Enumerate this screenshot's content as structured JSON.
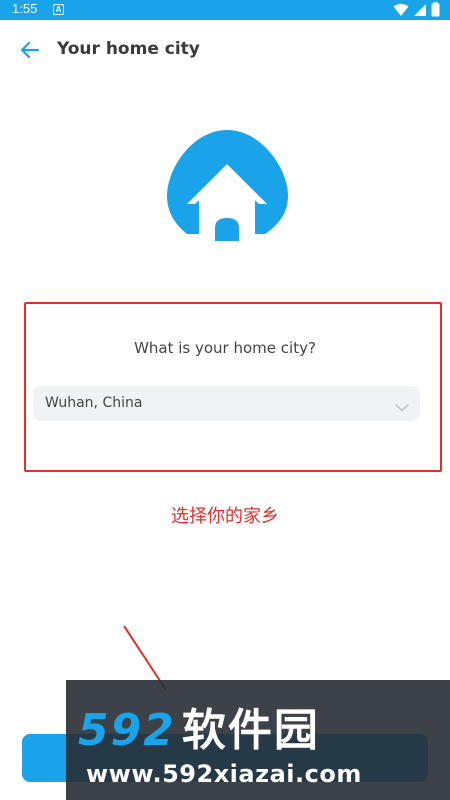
{
  "status_bar": {
    "time": "1:55",
    "notification_badge": "A",
    "icons": [
      "wifi-icon",
      "signal-icon",
      "battery-icon"
    ]
  },
  "header": {
    "title": "Your home city",
    "back_icon": "back-arrow-icon"
  },
  "illustration": {
    "icon": "house-icon"
  },
  "form": {
    "question": "What is your home city?",
    "city_value": "Wuhan, China",
    "dropdown_icon": "chevron-down-icon"
  },
  "annotation": {
    "text": "选择你的家乡"
  },
  "watermark": {
    "number": "592",
    "name": "软件园",
    "url": "www.592xiazai.com"
  },
  "colors": {
    "accent": "#1aa3e8",
    "annotation_red": "#e0312b",
    "select_bg": "#f1f2f5"
  }
}
